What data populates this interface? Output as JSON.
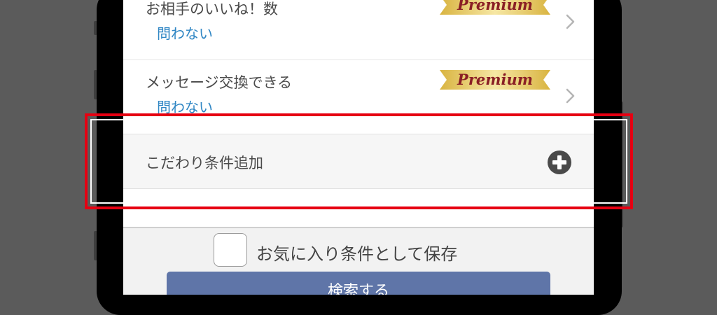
{
  "filters": [
    {
      "title": "お相手のいいね！数",
      "value": "問わない",
      "badge": "Premium"
    },
    {
      "title": "メッセージ交換できる",
      "value": "問わない",
      "badge": "Premium"
    }
  ],
  "add_condition": {
    "label": "こだわり条件追加"
  },
  "save": {
    "label": "お気に入り条件として保存"
  },
  "search_button": {
    "label": "検索する"
  },
  "colors": {
    "accent_blue": "#2f86c4",
    "button_blue": "#5f75a8",
    "premium_gold": "#e8c34f",
    "premium_text": "#8a1f25",
    "highlight_red": "#e60012"
  },
  "icons": [
    "chevron-right-icon",
    "plus-circle-icon"
  ]
}
